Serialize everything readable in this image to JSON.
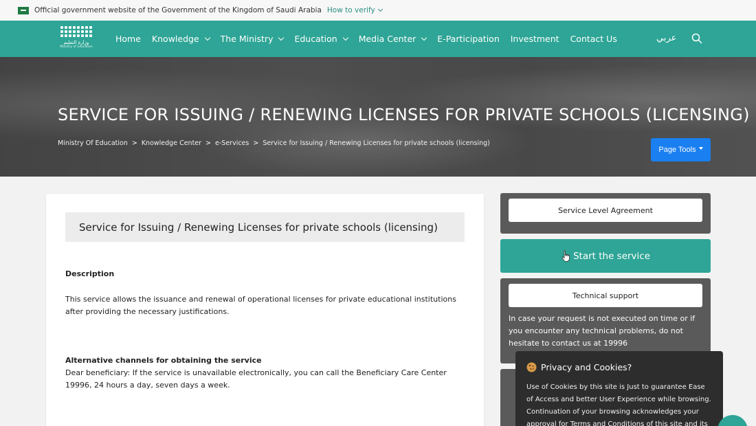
{
  "gov_bar": {
    "text": "Official government website of the Government of the Kingdom of Saudi Arabia",
    "verify": "How to verify"
  },
  "navbar": {
    "logo_text": "وزارة التعليم",
    "logo_sub": "Ministry of Education",
    "items": [
      {
        "label": "Home"
      },
      {
        "label": "Knowledge"
      },
      {
        "label": "The Ministry"
      },
      {
        "label": "Education"
      },
      {
        "label": "Media Center"
      },
      {
        "label": "E-Participation"
      },
      {
        "label": "Investment"
      },
      {
        "label": "Contact Us"
      }
    ],
    "lang": "عربي"
  },
  "hero": {
    "title": "SERVICE FOR ISSUING / RENEWING LICENSES FOR PRIVATE SCHOOLS (LICENSING)",
    "breadcrumb": [
      "Ministry Of Education",
      "Knowledge Center",
      "e-Services",
      "Service for Issuing / Renewing Licenses for private schools (licensing)"
    ],
    "page_tools": "Page Tools"
  },
  "main": {
    "title": "Service for Issuing / Renewing Licenses for private schools (licensing)",
    "description_label": "Description",
    "description": "This service allows the issuance and renewal of operational licenses for private educational institutions after providing the necessary justifications.",
    "alt_label": "Alternative channels for obtaining the service",
    "alt_text": "Dear beneficiary: If the service is unavailable electronically, you can call the Beneficiary Care Center 19996, 24 hours a day, seven days a week."
  },
  "sidebar": {
    "sla": "Service Level Agreement",
    "start": "Start the service",
    "support": "Technical support",
    "support_text": "In case your request is not executed on time or if you encounter any technical problems, do not hesitate to contact us at 19996"
  },
  "cookie": {
    "title": "Privacy and Cookies?",
    "text": "Use of Cookies by this site is Just to guarantee Ease of Access and better User Experience while browsing. Continuation of your browsing acknowledges your approval for Terms and Conditions of this site and its"
  },
  "colors": {
    "brand": "#2ea596",
    "primary_button": "#1a7ff0",
    "side_dark": "#5a5a5a"
  }
}
